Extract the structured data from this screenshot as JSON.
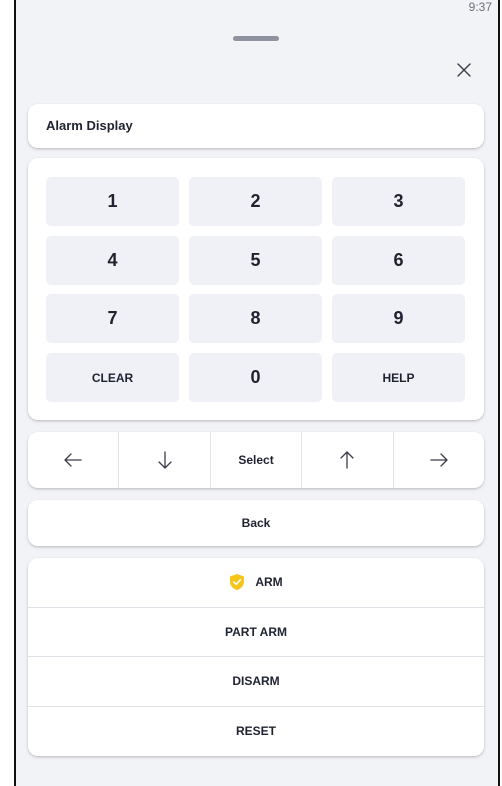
{
  "status_bar": {
    "time": "9:37"
  },
  "display": {
    "label": "Alarm Display"
  },
  "keypad": {
    "keys": [
      "1",
      "2",
      "3",
      "4",
      "5",
      "6",
      "7",
      "8",
      "9",
      "CLEAR",
      "0",
      "HELP"
    ]
  },
  "navigation": {
    "left_icon": "arrow-left-icon",
    "down_icon": "arrow-down-icon",
    "select_label": "Select",
    "up_icon": "arrow-up-icon",
    "right_icon": "arrow-right-icon"
  },
  "back": {
    "label": "Back"
  },
  "actions": {
    "arm": "ARM",
    "arm_icon": "shield-check-icon",
    "part_arm": "PART ARM",
    "disarm": "DISARM",
    "reset": "RESET"
  },
  "colors": {
    "background": "#f2f3f7",
    "card": "#ffffff",
    "key": "#f0f1f6",
    "shield": "#f6c518",
    "text": "#1f2230"
  }
}
